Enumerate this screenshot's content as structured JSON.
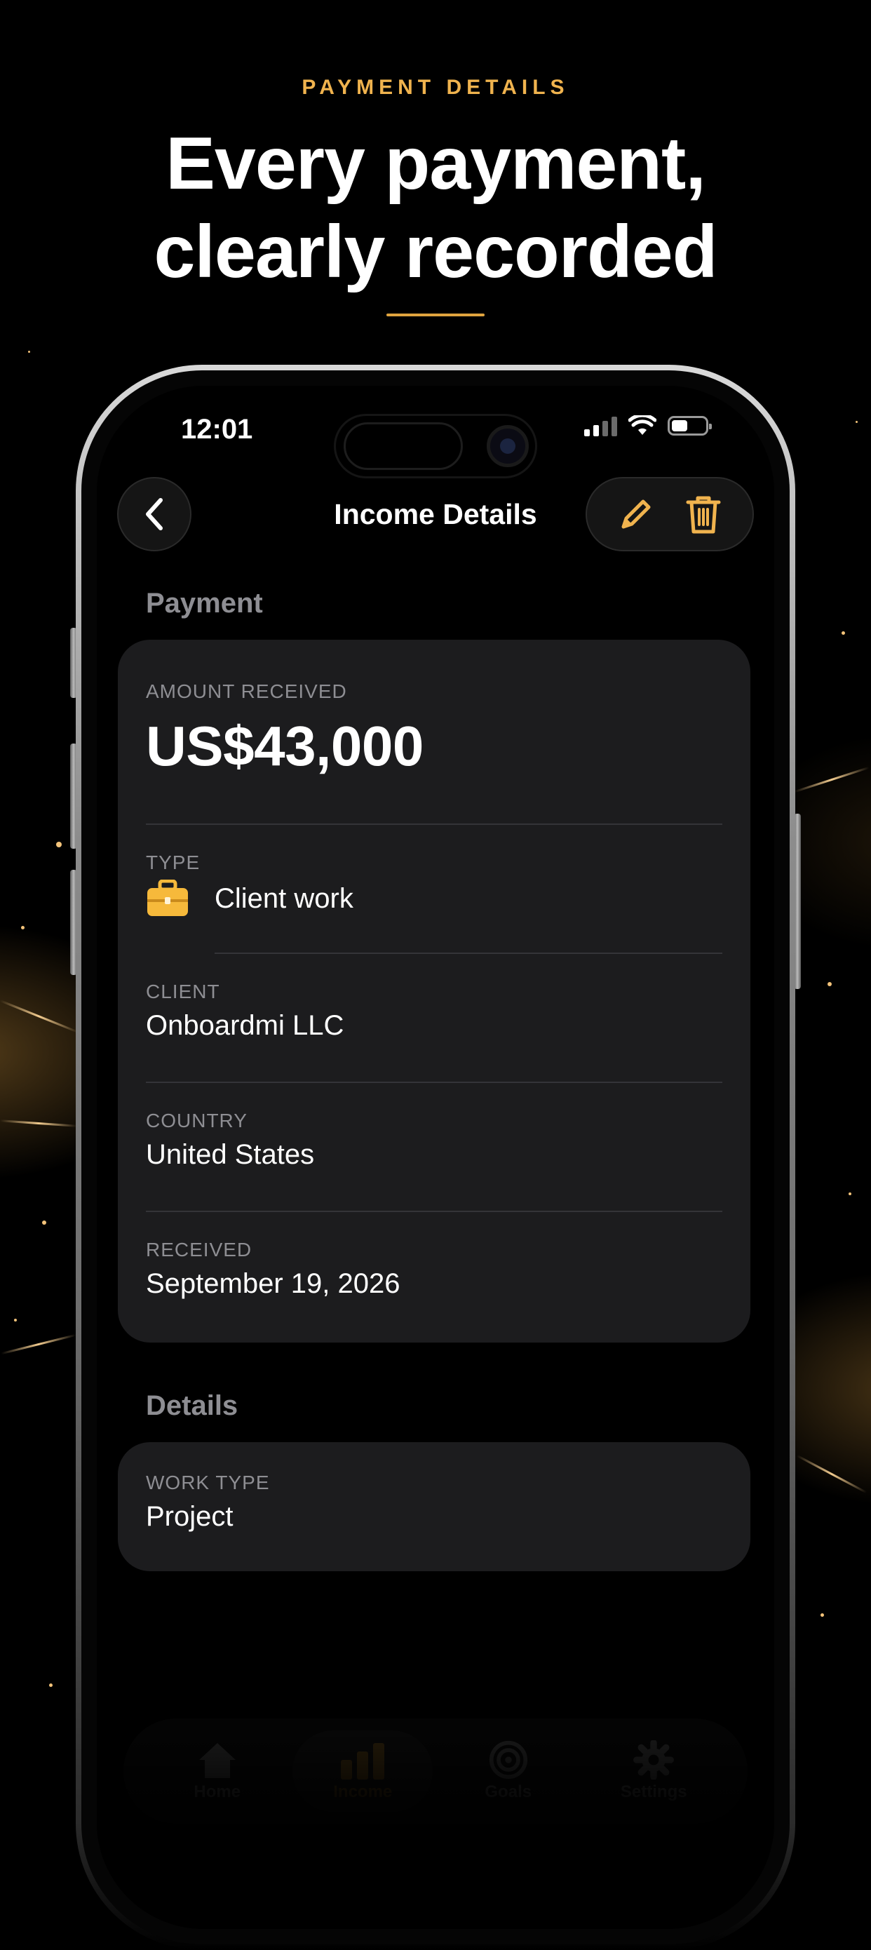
{
  "promo": {
    "eyebrow": "PAYMENT DETAILS",
    "headline_line1": "Every payment,",
    "headline_line2": "clearly recorded",
    "accent_color": "#f0b34e"
  },
  "status_bar": {
    "time": "12:01",
    "icons": [
      "cellular-signal-icon",
      "wifi-icon",
      "battery-icon"
    ]
  },
  "nav": {
    "title": "Income Details",
    "back_icon": "chevron-left-icon",
    "edit_icon": "pencil-icon",
    "delete_icon": "trash-icon"
  },
  "payment_section": {
    "label": "Payment",
    "amount_label": "AMOUNT RECEIVED",
    "amount_value": "US$43,000",
    "type_label": "TYPE",
    "type_value": "Client work",
    "type_icon": "briefcase-icon",
    "client_label": "CLIENT",
    "client_value": "Onboardmi LLC",
    "country_label": "COUNTRY",
    "country_value": "United States",
    "received_label": "RECEIVED",
    "received_value": "September 19, 2026"
  },
  "details_section": {
    "label": "Details",
    "work_type_label": "WORK TYPE",
    "work_type_value": "Project"
  },
  "tab_bar": {
    "tabs": [
      {
        "label": "Home",
        "icon": "house-icon"
      },
      {
        "label": "Income",
        "icon": "bar-chart-icon",
        "active": true
      },
      {
        "label": "Goals",
        "icon": "target-icon"
      },
      {
        "label": "Settings",
        "icon": "gear-icon"
      }
    ]
  }
}
